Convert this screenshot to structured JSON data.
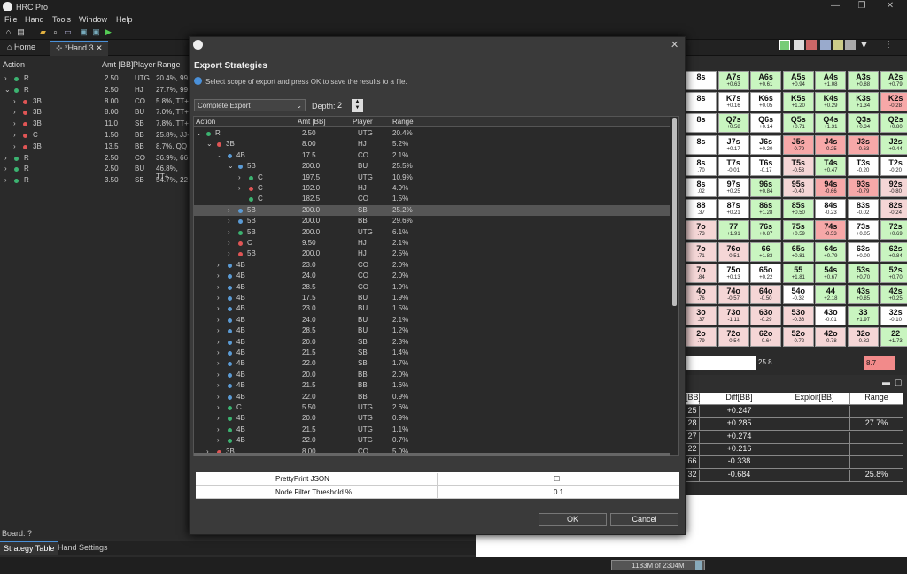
{
  "app": {
    "title": "HRC Pro"
  },
  "menu": [
    "File",
    "Hand",
    "Tools",
    "Window",
    "Help"
  ],
  "tabs": {
    "home": "Home",
    "hand": "*Hand 3"
  },
  "left_table": {
    "headers": [
      "Action",
      "Amt [BB]",
      "Player",
      "Range"
    ],
    "rows": [
      {
        "action": "R",
        "color": "green",
        "indent": 0,
        "expander": ">",
        "amt": "2.50",
        "player": "UTG",
        "range": "20.4%, 99"
      },
      {
        "action": "R",
        "color": "green",
        "indent": 0,
        "expander": "v",
        "amt": "2.50",
        "player": "HJ",
        "range": "27.7%, 99"
      },
      {
        "action": "3B",
        "color": "red",
        "indent": 1,
        "expander": ">",
        "amt": "8.00",
        "player": "CO",
        "range": "5.8%, TT+"
      },
      {
        "action": "3B",
        "color": "red",
        "indent": 1,
        "expander": ">",
        "amt": "8.00",
        "player": "BU",
        "range": "7.0%, TT+"
      },
      {
        "action": "3B",
        "color": "red",
        "indent": 1,
        "expander": ">",
        "amt": "11.0",
        "player": "SB",
        "range": "7.8%, TT+"
      },
      {
        "action": "C",
        "color": "red",
        "indent": 1,
        "expander": ">",
        "amt": "1.50",
        "player": "BB",
        "range": "25.8%, JJ-"
      },
      {
        "action": "3B",
        "color": "red",
        "indent": 1,
        "expander": ">",
        "amt": "13.5",
        "player": "BB",
        "range": "8.7%, QQ"
      },
      {
        "action": "R",
        "color": "green",
        "indent": 0,
        "expander": ">",
        "amt": "2.50",
        "player": "CO",
        "range": "36.9%, 66"
      },
      {
        "action": "R",
        "color": "green",
        "indent": 0,
        "expander": ">",
        "amt": "2.50",
        "player": "BU",
        "range": "46.8%, TT+"
      },
      {
        "action": "R",
        "color": "green",
        "indent": 0,
        "expander": ">",
        "amt": "3.50",
        "player": "SB",
        "range": "54.7%, 22"
      }
    ]
  },
  "dialog": {
    "title": "Export Strategies",
    "info": "Select scope of export and press OK to save the results to a file.",
    "scope": "Complete Export",
    "depth_label": "Depth:",
    "depth": "2",
    "tree_headers": [
      "Action",
      "Amt [BB]",
      "Player",
      "Range"
    ],
    "tree_rows": [
      {
        "expander": "v",
        "indent": 0,
        "color": "green",
        "action": "R",
        "amt": "2.50",
        "player": "UTG",
        "range": "20.4%"
      },
      {
        "expander": "v",
        "indent": 1,
        "color": "red",
        "action": "3B",
        "amt": "8.00",
        "player": "HJ",
        "range": "5.2%"
      },
      {
        "expander": "v",
        "indent": 2,
        "color": "blue",
        "action": "4B",
        "amt": "17.5",
        "player": "CO",
        "range": "2.1%"
      },
      {
        "expander": "v",
        "indent": 3,
        "color": "blue",
        "action": "5B",
        "amt": "200.0",
        "player": "BU",
        "range": "25.5%"
      },
      {
        "expander": ">",
        "indent": 4,
        "color": "green",
        "action": "C",
        "amt": "197.5",
        "player": "UTG",
        "range": "10.9%"
      },
      {
        "expander": ">",
        "indent": 4,
        "color": "red",
        "action": "C",
        "amt": "192.0",
        "player": "HJ",
        "range": "4.9%"
      },
      {
        "expander": "",
        "indent": 4,
        "color": "green",
        "action": "C",
        "amt": "182.5",
        "player": "CO",
        "range": "1.5%"
      },
      {
        "expander": ">",
        "indent": 3,
        "color": "blue",
        "action": "5B",
        "amt": "200.0",
        "player": "SB",
        "range": "25.2%",
        "selected": true
      },
      {
        "expander": ">",
        "indent": 3,
        "color": "blue",
        "action": "5B",
        "amt": "200.0",
        "player": "BB",
        "range": "29.6%"
      },
      {
        "expander": ">",
        "indent": 3,
        "color": "green",
        "action": "5B",
        "amt": "200.0",
        "player": "UTG",
        "range": "6.1%"
      },
      {
        "expander": ">",
        "indent": 3,
        "color": "red",
        "action": "C",
        "amt": "9.50",
        "player": "HJ",
        "range": "2.1%"
      },
      {
        "expander": ">",
        "indent": 3,
        "color": "red",
        "action": "5B",
        "amt": "200.0",
        "player": "HJ",
        "range": "2.5%"
      },
      {
        "expander": ">",
        "indent": 2,
        "color": "blue",
        "action": "4B",
        "amt": "23.0",
        "player": "CO",
        "range": "2.0%"
      },
      {
        "expander": ">",
        "indent": 2,
        "color": "blue",
        "action": "4B",
        "amt": "24.0",
        "player": "CO",
        "range": "2.0%"
      },
      {
        "expander": ">",
        "indent": 2,
        "color": "blue",
        "action": "4B",
        "amt": "28.5",
        "player": "CO",
        "range": "1.9%"
      },
      {
        "expander": ">",
        "indent": 2,
        "color": "blue",
        "action": "4B",
        "amt": "17.5",
        "player": "BU",
        "range": "1.9%"
      },
      {
        "expander": ">",
        "indent": 2,
        "color": "blue",
        "action": "4B",
        "amt": "23.0",
        "player": "BU",
        "range": "1.5%"
      },
      {
        "expander": ">",
        "indent": 2,
        "color": "blue",
        "action": "4B",
        "amt": "24.0",
        "player": "BU",
        "range": "2.1%"
      },
      {
        "expander": ">",
        "indent": 2,
        "color": "blue",
        "action": "4B",
        "amt": "28.5",
        "player": "BU",
        "range": "1.2%"
      },
      {
        "expander": ">",
        "indent": 2,
        "color": "blue",
        "action": "4B",
        "amt": "20.0",
        "player": "SB",
        "range": "2.3%"
      },
      {
        "expander": ">",
        "indent": 2,
        "color": "blue",
        "action": "4B",
        "amt": "21.5",
        "player": "SB",
        "range": "1.4%"
      },
      {
        "expander": ">",
        "indent": 2,
        "color": "blue",
        "action": "4B",
        "amt": "22.0",
        "player": "SB",
        "range": "1.7%"
      },
      {
        "expander": ">",
        "indent": 2,
        "color": "blue",
        "action": "4B",
        "amt": "20.0",
        "player": "BB",
        "range": "2.0%"
      },
      {
        "expander": ">",
        "indent": 2,
        "color": "blue",
        "action": "4B",
        "amt": "21.5",
        "player": "BB",
        "range": "1.6%"
      },
      {
        "expander": ">",
        "indent": 2,
        "color": "blue",
        "action": "4B",
        "amt": "22.0",
        "player": "BB",
        "range": "0.9%"
      },
      {
        "expander": ">",
        "indent": 2,
        "color": "green",
        "action": "C",
        "amt": "5.50",
        "player": "UTG",
        "range": "2.6%"
      },
      {
        "expander": ">",
        "indent": 2,
        "color": "green",
        "action": "4B",
        "amt": "20.0",
        "player": "UTG",
        "range": "0.9%"
      },
      {
        "expander": ">",
        "indent": 2,
        "color": "green",
        "action": "4B",
        "amt": "21.5",
        "player": "UTG",
        "range": "1.1%"
      },
      {
        "expander": ">",
        "indent": 2,
        "color": "green",
        "action": "4B",
        "amt": "22.0",
        "player": "UTG",
        "range": "0.7%"
      },
      {
        "expander": ">",
        "indent": 1,
        "color": "red",
        "action": "3B",
        "amt": "8.00",
        "player": "CO",
        "range": "5.0%"
      }
    ],
    "props": [
      {
        "label": "PrettyPrint JSON",
        "value": "☐"
      },
      {
        "label": "Node Filter Threshold %",
        "value": "0.1"
      }
    ],
    "ok": "OK",
    "cancel": "Cancel"
  },
  "grid": [
    [
      {
        "h": "8s",
        "v": ""
      },
      {
        "h": "A7s",
        "v": "+0.63",
        "c": "g"
      },
      {
        "h": "A6s",
        "v": "+0.61",
        "c": "g"
      },
      {
        "h": "A5s",
        "v": "+0.94",
        "c": "g"
      },
      {
        "h": "A4s",
        "v": "+1.08",
        "c": "g"
      },
      {
        "h": "A3s",
        "v": "+0.88",
        "c": "g"
      },
      {
        "h": "A2s",
        "v": "+0.79",
        "c": "g"
      }
    ],
    [
      {
        "h": "8s",
        "v": ""
      },
      {
        "h": "K7s",
        "v": "+0.16",
        "c": "w"
      },
      {
        "h": "K6s",
        "v": "+0.05",
        "c": "w"
      },
      {
        "h": "K5s",
        "v": "+1.20",
        "c": "g"
      },
      {
        "h": "K4s",
        "v": "+0.29",
        "c": "g"
      },
      {
        "h": "K3s",
        "v": "+1.34",
        "c": "g"
      },
      {
        "h": "K2s",
        "v": "-0.28",
        "c": "r"
      }
    ],
    [
      {
        "h": "8s",
        "v": ""
      },
      {
        "h": "Q7s",
        "v": "+0.58",
        "c": "g"
      },
      {
        "h": "Q6s",
        "v": "+0.14",
        "c": "w"
      },
      {
        "h": "Q5s",
        "v": "+0.71",
        "c": "g"
      },
      {
        "h": "Q4s",
        "v": "+1.31",
        "c": "g"
      },
      {
        "h": "Q3s",
        "v": "+0.34",
        "c": "g"
      },
      {
        "h": "Q2s",
        "v": "+0.80",
        "c": "g"
      }
    ],
    [
      {
        "h": "8s",
        "v": ""
      },
      {
        "h": "J7s",
        "v": "+0.17",
        "c": "w"
      },
      {
        "h": "J6s",
        "v": "+0.20",
        "c": "w"
      },
      {
        "h": "J5s",
        "v": "-0.79",
        "c": "r"
      },
      {
        "h": "J4s",
        "v": "-0.25",
        "c": "r"
      },
      {
        "h": "J3s",
        "v": "-0.63",
        "c": "r"
      },
      {
        "h": "J2s",
        "v": "+0.44",
        "c": "g"
      }
    ],
    [
      {
        "h": "8s",
        "v": ".70"
      },
      {
        "h": "T7s",
        "v": "-0.01",
        "c": "w"
      },
      {
        "h": "T6s",
        "v": "-0.17",
        "c": "w"
      },
      {
        "h": "T5s",
        "v": "-0.53",
        "c": "p"
      },
      {
        "h": "T4s",
        "v": "+0.47",
        "c": "g"
      },
      {
        "h": "T3s",
        "v": "-0.20",
        "c": "w"
      },
      {
        "h": "T2s",
        "v": "-0.20",
        "c": "w"
      }
    ],
    [
      {
        "h": "8s",
        "v": ".02"
      },
      {
        "h": "97s",
        "v": "+0.25",
        "c": "w"
      },
      {
        "h": "96s",
        "v": "+0.84",
        "c": "g"
      },
      {
        "h": "95s",
        "v": "-0.40",
        "c": "p"
      },
      {
        "h": "94s",
        "v": "-0.66",
        "c": "r"
      },
      {
        "h": "93s",
        "v": "-0.79",
        "c": "r"
      },
      {
        "h": "92s",
        "v": "-0.80",
        "c": "p"
      }
    ],
    [
      {
        "h": "88",
        "v": ".37"
      },
      {
        "h": "87s",
        "v": "+0.21",
        "c": "w"
      },
      {
        "h": "86s",
        "v": "+1.28",
        "c": "g"
      },
      {
        "h": "85s",
        "v": "+0.50",
        "c": "g"
      },
      {
        "h": "84s",
        "v": "-0.23",
        "c": "w"
      },
      {
        "h": "83s",
        "v": "-0.02",
        "c": "w"
      },
      {
        "h": "82s",
        "v": "-0.24",
        "c": "p"
      }
    ],
    [
      {
        "h": "7o",
        "v": ".73",
        "c": "p"
      },
      {
        "h": "77",
        "v": "+1.91",
        "c": "g"
      },
      {
        "h": "76s",
        "v": "+0.87",
        "c": "g"
      },
      {
        "h": "75s",
        "v": "+0.59",
        "c": "g"
      },
      {
        "h": "74s",
        "v": "-0.53",
        "c": "r"
      },
      {
        "h": "73s",
        "v": "+0.05",
        "c": "w"
      },
      {
        "h": "72s",
        "v": "+0.69",
        "c": "g"
      }
    ],
    [
      {
        "h": "7o",
        "v": ".71",
        "c": "p"
      },
      {
        "h": "76o",
        "v": "-0.51",
        "c": "p"
      },
      {
        "h": "66",
        "v": "+1.83",
        "c": "g"
      },
      {
        "h": "65s",
        "v": "+0.81",
        "c": "g"
      },
      {
        "h": "64s",
        "v": "+0.79",
        "c": "g"
      },
      {
        "h": "63s",
        "v": "+0.00",
        "c": "w"
      },
      {
        "h": "62s",
        "v": "+0.84",
        "c": "g"
      }
    ],
    [
      {
        "h": "7o",
        "v": ".84",
        "c": "p"
      },
      {
        "h": "75o",
        "v": "+0.13",
        "c": "w"
      },
      {
        "h": "65o",
        "v": "+0.22",
        "c": "w"
      },
      {
        "h": "55",
        "v": "+1.81",
        "c": "g"
      },
      {
        "h": "54s",
        "v": "+0.67",
        "c": "g"
      },
      {
        "h": "53s",
        "v": "+0.70",
        "c": "g"
      },
      {
        "h": "52s",
        "v": "+0.70",
        "c": "g"
      }
    ],
    [
      {
        "h": "4o",
        "v": ".76",
        "c": "p"
      },
      {
        "h": "74o",
        "v": "-0.57",
        "c": "p"
      },
      {
        "h": "64o",
        "v": "-0.50",
        "c": "p"
      },
      {
        "h": "54o",
        "v": "-0.32",
        "c": "w"
      },
      {
        "h": "44",
        "v": "+2.18",
        "c": "g"
      },
      {
        "h": "43s",
        "v": "+0.85",
        "c": "g"
      },
      {
        "h": "42s",
        "v": "+0.25",
        "c": "g"
      }
    ],
    [
      {
        "h": "3o",
        "v": ".37",
        "c": "p"
      },
      {
        "h": "73o",
        "v": "-1.11",
        "c": "p"
      },
      {
        "h": "63o",
        "v": "-0.29",
        "c": "p"
      },
      {
        "h": "53o",
        "v": "-0.36",
        "c": "p"
      },
      {
        "h": "43o",
        "v": "-0.01",
        "c": "w"
      },
      {
        "h": "33",
        "v": "+1.97",
        "c": "g"
      },
      {
        "h": "32s",
        "v": "-0.10",
        "c": "w"
      }
    ],
    [
      {
        "h": "2o",
        "v": ".79",
        "c": "p"
      },
      {
        "h": "72o",
        "v": "-0.54",
        "c": "p"
      },
      {
        "h": "62o",
        "v": "-0.64",
        "c": "p"
      },
      {
        "h": "52o",
        "v": "-0.72",
        "c": "p"
      },
      {
        "h": "42o",
        "v": "-0.78",
        "c": "p"
      },
      {
        "h": "32o",
        "v": "-0.82",
        "c": "p"
      },
      {
        "h": "22",
        "v": "+1.73",
        "c": "g"
      }
    ]
  ],
  "range_bar": {
    "left_value": "25.8",
    "right_value": "8.7"
  },
  "stats": {
    "headers": [
      "[BB]",
      "Diff[BB]",
      "Exploit[BB]",
      "Range"
    ],
    "rows": [
      [
        "25",
        "+0.247",
        "",
        ""
      ],
      [
        "28",
        "+0.285",
        "",
        "27.7%"
      ],
      [
        "27",
        "+0.274",
        "",
        ""
      ],
      [
        "22",
        "+0.216",
        "",
        ""
      ],
      [
        "66",
        "-0.338",
        "",
        ""
      ],
      [
        "32",
        "-0.684",
        "",
        "25.8%"
      ]
    ]
  },
  "board_label": "Board: ?",
  "bottom_tabs": [
    "Strategy Table",
    "Hand Settings"
  ],
  "memory": "1183M of 2304M"
}
